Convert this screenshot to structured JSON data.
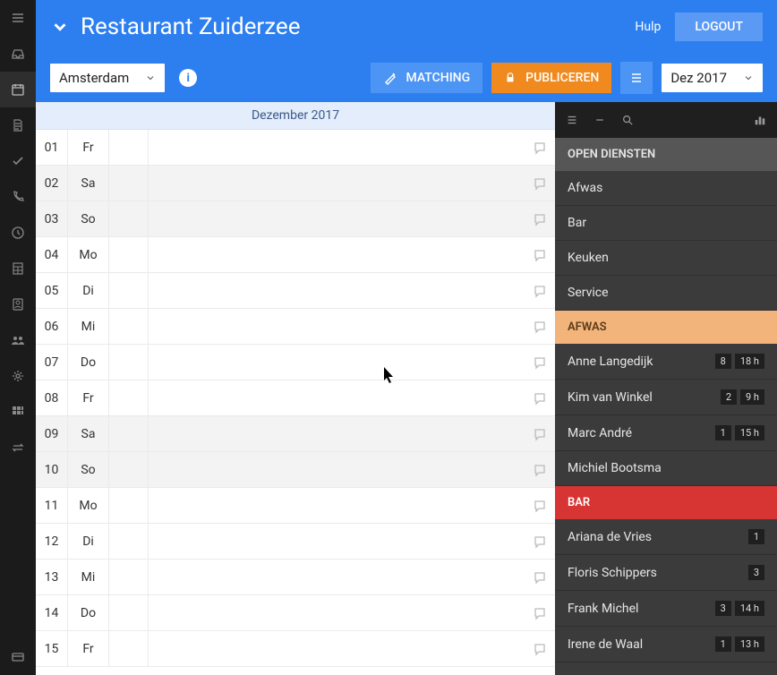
{
  "colors": {
    "blue": "#2d7ff0",
    "orange": "#f08a1e",
    "peach": "#f2b47a",
    "red": "#d73434"
  },
  "header": {
    "title": "Restaurant Zuiderzee",
    "help_label": "Hulp",
    "logout_label": "LOGOUT"
  },
  "toolbar": {
    "location_label": "Amsterdam",
    "matching_label": "MATCHING",
    "publish_label": "PUBLICEREN",
    "date_label": "Dez 2017"
  },
  "calendar": {
    "month_header": "Dezember 2017",
    "days": [
      {
        "num": "01",
        "name": "Fr",
        "weekend": false
      },
      {
        "num": "02",
        "name": "Sa",
        "weekend": true
      },
      {
        "num": "03",
        "name": "So",
        "weekend": true
      },
      {
        "num": "04",
        "name": "Mo",
        "weekend": false
      },
      {
        "num": "05",
        "name": "Di",
        "weekend": false
      },
      {
        "num": "06",
        "name": "Mi",
        "weekend": false
      },
      {
        "num": "07",
        "name": "Do",
        "weekend": false
      },
      {
        "num": "08",
        "name": "Fr",
        "weekend": false
      },
      {
        "num": "09",
        "name": "Sa",
        "weekend": true
      },
      {
        "num": "10",
        "name": "So",
        "weekend": true
      },
      {
        "num": "11",
        "name": "Mo",
        "weekend": false
      },
      {
        "num": "12",
        "name": "Di",
        "weekend": false
      },
      {
        "num": "13",
        "name": "Mi",
        "weekend": false
      },
      {
        "num": "14",
        "name": "Do",
        "weekend": false
      },
      {
        "num": "15",
        "name": "Fr",
        "weekend": false
      }
    ]
  },
  "sidepanel": {
    "open_shifts_header": "OPEN DIENSTEN",
    "open_shifts": [
      "Afwas",
      "Bar",
      "Keuken",
      "Service"
    ],
    "sections": [
      {
        "key": "afwas",
        "label": "AFWAS",
        "color": "peach",
        "people": [
          {
            "name": "Anne Langedijk",
            "count": "8",
            "hours": "18 h"
          },
          {
            "name": "Kim van Winkel",
            "count": "2",
            "hours": "9 h"
          },
          {
            "name": "Marc André",
            "count": "1",
            "hours": "15 h"
          },
          {
            "name": "Michiel Bootsma"
          }
        ]
      },
      {
        "key": "bar",
        "label": "BAR",
        "color": "red",
        "people": [
          {
            "name": "Ariana de Vries",
            "count": "1"
          },
          {
            "name": "Floris Schippers",
            "count": "3"
          },
          {
            "name": "Frank Michel",
            "count": "3",
            "hours": "14 h"
          },
          {
            "name": "Irene de Waal",
            "count": "1",
            "hours": "13 h"
          }
        ]
      }
    ]
  }
}
